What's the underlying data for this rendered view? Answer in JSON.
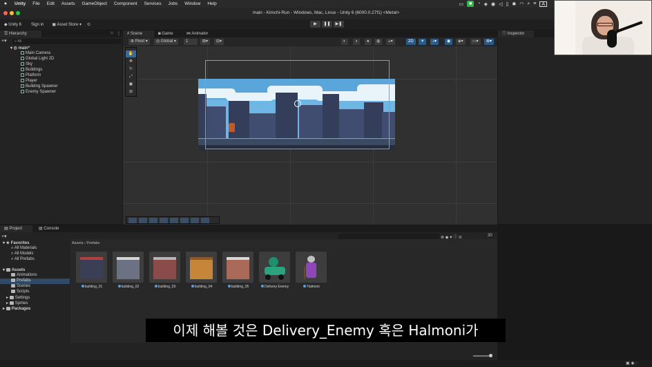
{
  "menubar": {
    "app": "Unity",
    "items": [
      "File",
      "Edit",
      "Assets",
      "GameObject",
      "Component",
      "Services",
      "Jobs",
      "Window",
      "Help"
    ]
  },
  "window": {
    "title": "main - Kimchi-Run - Windows, Mac, Linux - Unity 6 (6000.0.27f1) <Metal>"
  },
  "toolbar": {
    "account": "Unity 6",
    "signin": "Sign in",
    "asset_store": "Asset Store"
  },
  "hierarchy": {
    "tab": "Hierarchy",
    "search_placeholder": "All",
    "scene": "main*",
    "items": [
      "Main Camera",
      "Global Light 2D",
      "Sky",
      "Buildings",
      "Platform",
      "Player",
      "Building Spawner",
      "Enemy Spawner"
    ]
  },
  "scene_tabs": [
    "Scene",
    "Game",
    "Animator"
  ],
  "scene_toolbar": {
    "pivot": "Pivot",
    "global": "Global",
    "grid_value": "1",
    "mode_2d": "2D"
  },
  "inspector": {
    "tab": "Inspector"
  },
  "project": {
    "tabs": [
      "Project",
      "Console"
    ],
    "favorites_label": "Favorites",
    "favorites": [
      "All Materials",
      "All Models",
      "All Prefabs"
    ],
    "assets_label": "Assets",
    "folders": [
      "Animations",
      "Prefabs",
      "Scenes",
      "Scripts",
      "Settings",
      "Sprites"
    ],
    "packages_label": "Packages",
    "breadcrumb_root": "Assets",
    "breadcrumb_current": "Prefabs",
    "count": "30",
    "prefabs": [
      "building_01",
      "building_02",
      "building_03",
      "building_04",
      "building_05",
      "Delivery Enemy",
      "Halmoni"
    ]
  },
  "subtitle": "이제 해볼 것은 Delivery_Enemy 혹은 Halmoni가",
  "colors": {
    "accent_blue": "#2a5a86",
    "sky": "#6eb6e3",
    "record_green": "#2fb84a"
  }
}
